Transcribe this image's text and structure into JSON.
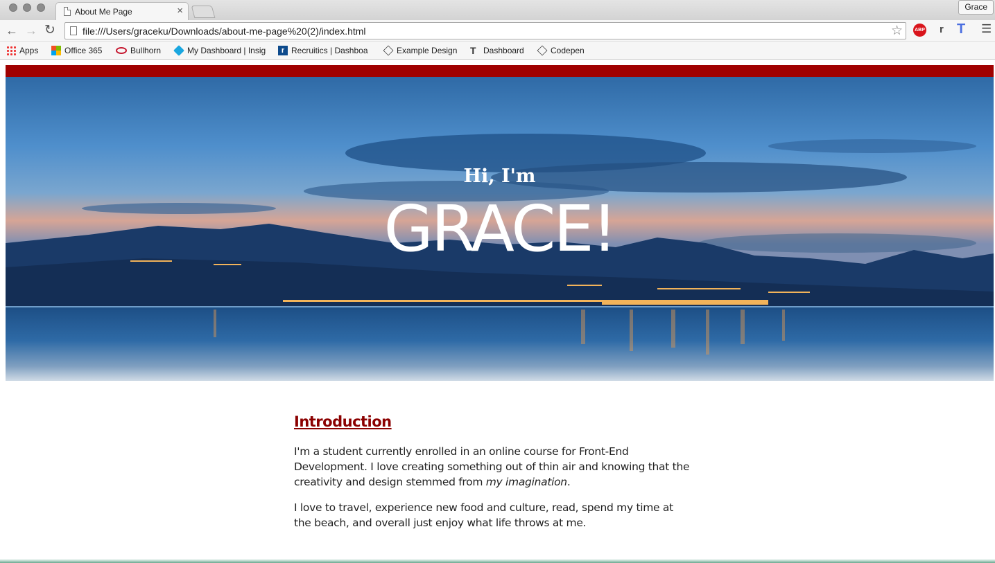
{
  "browser": {
    "tab_title": "About Me Page",
    "tab_close": "×",
    "profile_name": "Grace",
    "url": "file:///Users/graceku/Downloads/about-me-page%20(2)/index.html",
    "ext_abp": "ABP",
    "ext_r": "r",
    "ext_t": "T",
    "bookmarks": [
      {
        "label": "Apps"
      },
      {
        "label": "Office 365"
      },
      {
        "label": "Bullhorn"
      },
      {
        "label": "My Dashboard | Insig"
      },
      {
        "label": "Recruitics | Dashboa"
      },
      {
        "label": "Example Design"
      },
      {
        "label": "Dashboard"
      },
      {
        "label": "Codepen"
      }
    ]
  },
  "hero": {
    "greeting": "Hi, I'm",
    "name": "GRACE!"
  },
  "intro": {
    "heading": "Introduction",
    "para1_a": "I'm a student currently enrolled in an online course for Front-End Development. I love creating something out of thin air and knowing that the creativity and design stemmed from ",
    "para1_em": "my imagination",
    "para1_b": ".",
    "para2": "I love to travel, experience new food and culture, read, spend my time at the beach, and overall just enjoy what life throws at me."
  },
  "colors": {
    "accent_red": "#a00000",
    "heading_red": "#8b0000"
  }
}
